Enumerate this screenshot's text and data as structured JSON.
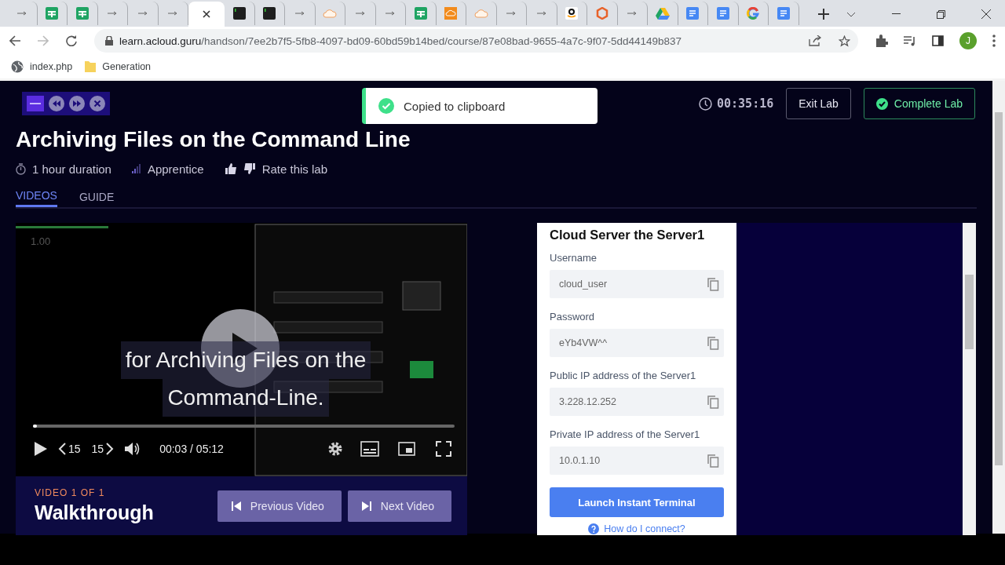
{
  "browser": {
    "tabs": [
      {
        "kind": "arrow",
        "selected": false
      },
      {
        "kind": "sheets",
        "selected": false
      },
      {
        "kind": "sheets",
        "selected": false
      },
      {
        "kind": "arrow",
        "selected": false
      },
      {
        "kind": "arrow",
        "selected": false
      },
      {
        "kind": "arrow",
        "selected": false
      },
      {
        "kind": "blank",
        "selected": true
      },
      {
        "kind": "terminal",
        "selected": false
      },
      {
        "kind": "terminal",
        "selected": false
      },
      {
        "kind": "arrow",
        "selected": false
      },
      {
        "kind": "cloud",
        "selected": false
      },
      {
        "kind": "arrow",
        "selected": false
      },
      {
        "kind": "arrow",
        "selected": false
      },
      {
        "kind": "sheets",
        "selected": false
      },
      {
        "kind": "orange",
        "selected": false
      },
      {
        "kind": "cloud",
        "selected": false
      },
      {
        "kind": "arrow",
        "selected": false
      },
      {
        "kind": "arrow",
        "selected": false
      },
      {
        "kind": "amazon",
        "selected": false
      },
      {
        "kind": "office",
        "selected": false
      },
      {
        "kind": "arrow",
        "selected": false
      },
      {
        "kind": "drive",
        "selected": false
      },
      {
        "kind": "docs",
        "selected": false
      },
      {
        "kind": "docs",
        "selected": false
      },
      {
        "kind": "google",
        "selected": false
      },
      {
        "kind": "docs",
        "selected": false
      }
    ],
    "url": {
      "host": "learn.acloud.guru",
      "path": "/handson/7ee2b7f5-5fb8-4097-bd09-60bd59b14bed/course/87e08bad-9655-4a7c-9f07-5dd44149b837"
    },
    "avatar": "J",
    "bookmarks": [
      {
        "kind": "globe",
        "label": "index.php"
      },
      {
        "kind": "folder",
        "label": "Generation"
      }
    ]
  },
  "lab": {
    "toast": "Copied to clipboard",
    "timer": "00:35:16",
    "exit_button": "Exit Lab",
    "complete_button": "Complete Lab",
    "title": "Archiving Files on the Command Line",
    "duration": "1 hour duration",
    "level_name": "Apprentice",
    "rate": "Rate this lab",
    "tabs": [
      {
        "label": "VIDEOS",
        "selected": true
      },
      {
        "label": "GUIDE",
        "selected": false
      }
    ],
    "player": {
      "speed": "1.00",
      "caption_lines": [
        "for Archiving Files on the",
        "Command-Line."
      ],
      "level": 0.01,
      "skip_back": "15",
      "skip_forward": "15",
      "time": "00:03 / 05:12"
    },
    "video_info": {
      "counter": "VIDEO 1 OF 1",
      "title": "Walkthrough",
      "prev_button": "Previous Video",
      "next_button": "Next Video"
    },
    "server": {
      "title": "Cloud Server the Server1",
      "fields": [
        {
          "label": "Username",
          "value": "cloud_user"
        },
        {
          "label": "Password",
          "value": "eYb4VW^^"
        },
        {
          "label": "Public IP address of the Server1",
          "value": "3.228.12.252"
        },
        {
          "label": "Private IP address of the Server1",
          "value": "10.0.1.10"
        }
      ],
      "launch_button": "Launch Instant Terminal",
      "help_link": "How do I connect?"
    }
  }
}
